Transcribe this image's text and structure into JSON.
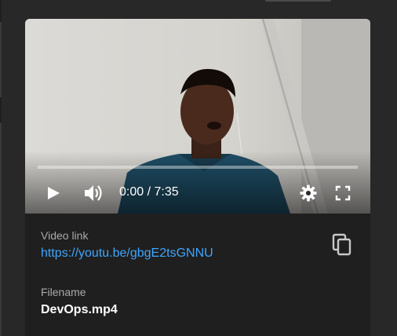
{
  "player": {
    "progress_fraction": 0.0,
    "time_current": "0:00",
    "time_separator": "/",
    "time_total": "7:35",
    "icons": [
      "play-icon",
      "volume-icon",
      "settings-gear-icon",
      "fullscreen-icon"
    ]
  },
  "info": {
    "video_link_label": "Video link",
    "video_link": "https://youtu.be/gbgE2tsGNNU",
    "filename_label": "Filename",
    "filename": "DevOps.mp4",
    "copy_icon": "copy-icon"
  },
  "colors": {
    "background": "#282828",
    "card": "#1f1f1f",
    "link": "#3ea6ff",
    "progress": "#ff0000",
    "label": "#aaaaaa"
  }
}
